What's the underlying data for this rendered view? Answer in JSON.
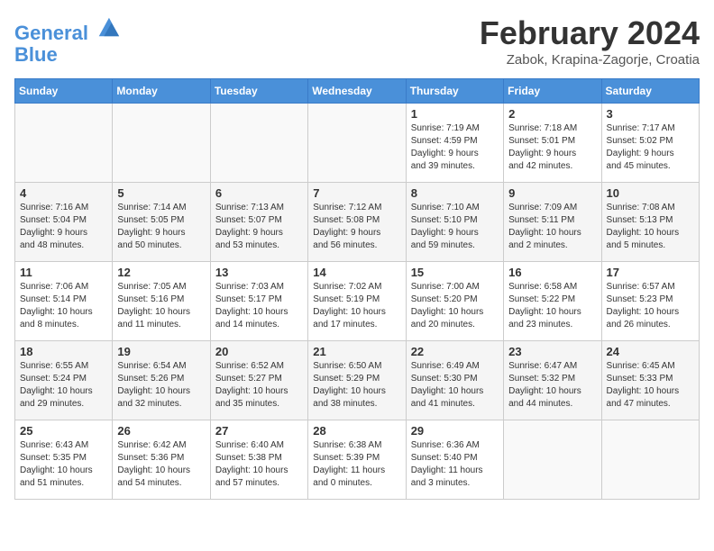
{
  "header": {
    "logo_line1": "General",
    "logo_line2": "Blue",
    "month_year": "February 2024",
    "location": "Zabok, Krapina-Zagorje, Croatia"
  },
  "days_of_week": [
    "Sunday",
    "Monday",
    "Tuesday",
    "Wednesday",
    "Thursday",
    "Friday",
    "Saturday"
  ],
  "weeks": [
    [
      {
        "day": "",
        "info": ""
      },
      {
        "day": "",
        "info": ""
      },
      {
        "day": "",
        "info": ""
      },
      {
        "day": "",
        "info": ""
      },
      {
        "day": "1",
        "info": "Sunrise: 7:19 AM\nSunset: 4:59 PM\nDaylight: 9 hours\nand 39 minutes."
      },
      {
        "day": "2",
        "info": "Sunrise: 7:18 AM\nSunset: 5:01 PM\nDaylight: 9 hours\nand 42 minutes."
      },
      {
        "day": "3",
        "info": "Sunrise: 7:17 AM\nSunset: 5:02 PM\nDaylight: 9 hours\nand 45 minutes."
      }
    ],
    [
      {
        "day": "4",
        "info": "Sunrise: 7:16 AM\nSunset: 5:04 PM\nDaylight: 9 hours\nand 48 minutes."
      },
      {
        "day": "5",
        "info": "Sunrise: 7:14 AM\nSunset: 5:05 PM\nDaylight: 9 hours\nand 50 minutes."
      },
      {
        "day": "6",
        "info": "Sunrise: 7:13 AM\nSunset: 5:07 PM\nDaylight: 9 hours\nand 53 minutes."
      },
      {
        "day": "7",
        "info": "Sunrise: 7:12 AM\nSunset: 5:08 PM\nDaylight: 9 hours\nand 56 minutes."
      },
      {
        "day": "8",
        "info": "Sunrise: 7:10 AM\nSunset: 5:10 PM\nDaylight: 9 hours\nand 59 minutes."
      },
      {
        "day": "9",
        "info": "Sunrise: 7:09 AM\nSunset: 5:11 PM\nDaylight: 10 hours\nand 2 minutes."
      },
      {
        "day": "10",
        "info": "Sunrise: 7:08 AM\nSunset: 5:13 PM\nDaylight: 10 hours\nand 5 minutes."
      }
    ],
    [
      {
        "day": "11",
        "info": "Sunrise: 7:06 AM\nSunset: 5:14 PM\nDaylight: 10 hours\nand 8 minutes."
      },
      {
        "day": "12",
        "info": "Sunrise: 7:05 AM\nSunset: 5:16 PM\nDaylight: 10 hours\nand 11 minutes."
      },
      {
        "day": "13",
        "info": "Sunrise: 7:03 AM\nSunset: 5:17 PM\nDaylight: 10 hours\nand 14 minutes."
      },
      {
        "day": "14",
        "info": "Sunrise: 7:02 AM\nSunset: 5:19 PM\nDaylight: 10 hours\nand 17 minutes."
      },
      {
        "day": "15",
        "info": "Sunrise: 7:00 AM\nSunset: 5:20 PM\nDaylight: 10 hours\nand 20 minutes."
      },
      {
        "day": "16",
        "info": "Sunrise: 6:58 AM\nSunset: 5:22 PM\nDaylight: 10 hours\nand 23 minutes."
      },
      {
        "day": "17",
        "info": "Sunrise: 6:57 AM\nSunset: 5:23 PM\nDaylight: 10 hours\nand 26 minutes."
      }
    ],
    [
      {
        "day": "18",
        "info": "Sunrise: 6:55 AM\nSunset: 5:24 PM\nDaylight: 10 hours\nand 29 minutes."
      },
      {
        "day": "19",
        "info": "Sunrise: 6:54 AM\nSunset: 5:26 PM\nDaylight: 10 hours\nand 32 minutes."
      },
      {
        "day": "20",
        "info": "Sunrise: 6:52 AM\nSunset: 5:27 PM\nDaylight: 10 hours\nand 35 minutes."
      },
      {
        "day": "21",
        "info": "Sunrise: 6:50 AM\nSunset: 5:29 PM\nDaylight: 10 hours\nand 38 minutes."
      },
      {
        "day": "22",
        "info": "Sunrise: 6:49 AM\nSunset: 5:30 PM\nDaylight: 10 hours\nand 41 minutes."
      },
      {
        "day": "23",
        "info": "Sunrise: 6:47 AM\nSunset: 5:32 PM\nDaylight: 10 hours\nand 44 minutes."
      },
      {
        "day": "24",
        "info": "Sunrise: 6:45 AM\nSunset: 5:33 PM\nDaylight: 10 hours\nand 47 minutes."
      }
    ],
    [
      {
        "day": "25",
        "info": "Sunrise: 6:43 AM\nSunset: 5:35 PM\nDaylight: 10 hours\nand 51 minutes."
      },
      {
        "day": "26",
        "info": "Sunrise: 6:42 AM\nSunset: 5:36 PM\nDaylight: 10 hours\nand 54 minutes."
      },
      {
        "day": "27",
        "info": "Sunrise: 6:40 AM\nSunset: 5:38 PM\nDaylight: 10 hours\nand 57 minutes."
      },
      {
        "day": "28",
        "info": "Sunrise: 6:38 AM\nSunset: 5:39 PM\nDaylight: 11 hours\nand 0 minutes."
      },
      {
        "day": "29",
        "info": "Sunrise: 6:36 AM\nSunset: 5:40 PM\nDaylight: 11 hours\nand 3 minutes."
      },
      {
        "day": "",
        "info": ""
      },
      {
        "day": "",
        "info": ""
      }
    ]
  ]
}
